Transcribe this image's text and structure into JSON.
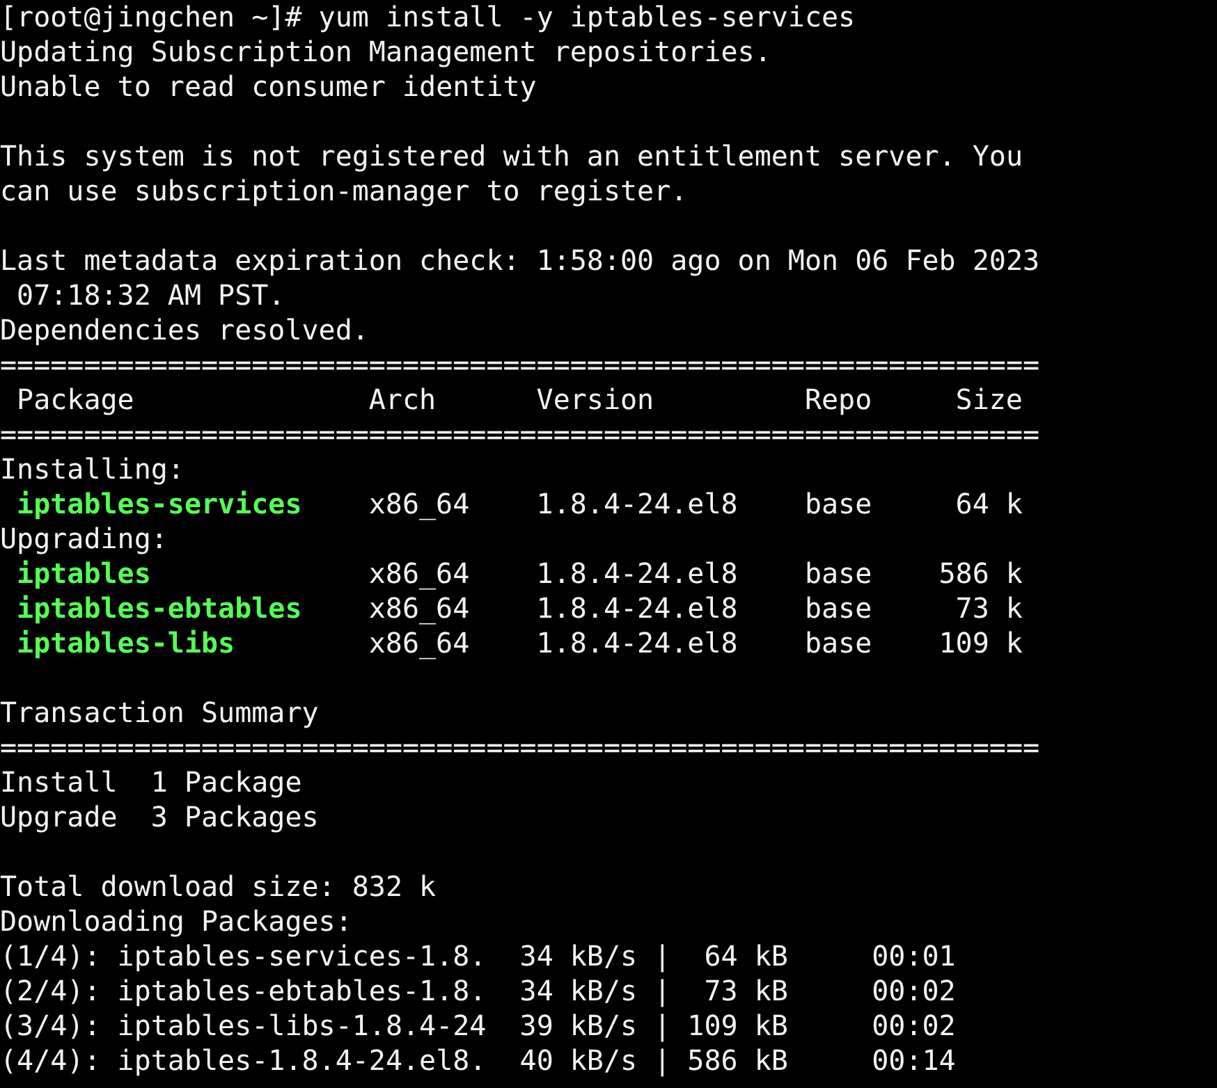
{
  "terminal": {
    "lines": [
      {
        "kind": "text",
        "text": "[root@jingchen ~]# yum install -y iptables-services"
      },
      {
        "kind": "text",
        "text": "Updating Subscription Management repositories."
      },
      {
        "kind": "text",
        "text": "Unable to read consumer identity"
      },
      {
        "kind": "blank"
      },
      {
        "kind": "text",
        "text": "This system is not registered with an entitlement server. You"
      },
      {
        "kind": "text",
        "text": "can use subscription-manager to register."
      },
      {
        "kind": "blank"
      },
      {
        "kind": "text",
        "text": "Last metadata expiration check: 1:58:00 ago on Mon 06 Feb 2023"
      },
      {
        "kind": "text",
        "text": " 07:18:32 AM PST."
      },
      {
        "kind": "text",
        "text": "Dependencies resolved."
      },
      {
        "kind": "rule",
        "text": "=============================================================="
      },
      {
        "kind": "header",
        "cells": [
          "Package",
          "Arch",
          "Version",
          "Repo",
          "Size"
        ]
      },
      {
        "kind": "rule",
        "text": "=============================================================="
      },
      {
        "kind": "text",
        "text": "Installing:"
      },
      {
        "kind": "package",
        "cells": [
          "iptables-services",
          "x86_64",
          "1.8.4-24.el8",
          "base",
          "64 k"
        ]
      },
      {
        "kind": "text",
        "text": "Upgrading:"
      },
      {
        "kind": "package",
        "cells": [
          "iptables",
          "x86_64",
          "1.8.4-24.el8",
          "base",
          "586 k"
        ]
      },
      {
        "kind": "package",
        "cells": [
          "iptables-ebtables",
          "x86_64",
          "1.8.4-24.el8",
          "base",
          "73 k"
        ]
      },
      {
        "kind": "package",
        "cells": [
          "iptables-libs",
          "x86_64",
          "1.8.4-24.el8",
          "base",
          "109 k"
        ]
      },
      {
        "kind": "blank"
      },
      {
        "kind": "text",
        "text": "Transaction Summary"
      },
      {
        "kind": "rule",
        "text": "=============================================================="
      },
      {
        "kind": "text",
        "text": "Install  1 Package"
      },
      {
        "kind": "text",
        "text": "Upgrade  3 Packages"
      },
      {
        "kind": "blank"
      },
      {
        "kind": "text",
        "text": "Total download size: 832 k"
      },
      {
        "kind": "text",
        "text": "Downloading Packages:"
      },
      {
        "kind": "text",
        "text": "(1/4): iptables-services-1.8.  34 kB/s |  64 kB     00:01"
      },
      {
        "kind": "text",
        "text": "(2/4): iptables-ebtables-1.8.  34 kB/s |  73 kB     00:02"
      },
      {
        "kind": "text",
        "text": "(3/4): iptables-libs-1.8.4-24  39 kB/s | 109 kB     00:02"
      },
      {
        "kind": "text",
        "text": "(4/4): iptables-1.8.4-24.el8.  40 kB/s | 586 kB     00:14"
      }
    ]
  }
}
